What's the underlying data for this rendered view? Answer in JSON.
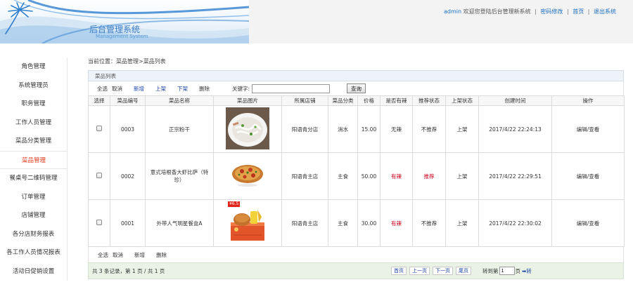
{
  "header": {
    "system_title": "后台管理系统",
    "system_subtitle": "Management System",
    "user": "admin",
    "welcome": "欢迎您登陆后台管理新系统",
    "links": [
      "密码修改",
      "首页",
      "退出系统"
    ],
    "separator": "|"
  },
  "sidebar": {
    "items": [
      {
        "label": "角色管理",
        "active": false
      },
      {
        "label": "系统管理员",
        "active": false
      },
      {
        "label": "职务管理",
        "active": false
      },
      {
        "label": "工作人员管理",
        "active": false
      },
      {
        "label": "菜品分类管理",
        "active": false
      },
      {
        "label": "菜品管理",
        "active": true
      },
      {
        "label": "餐桌号二维码管理",
        "active": false
      },
      {
        "label": "订单管理",
        "active": false
      },
      {
        "label": "店铺管理",
        "active": false
      },
      {
        "label": "各分店财务报表",
        "active": false
      },
      {
        "label": "各工作人员情况报表",
        "active": false
      },
      {
        "label": "活动日促销设置",
        "active": false
      }
    ]
  },
  "breadcrumb": "当前位置：菜品管理>菜品列表",
  "panel": {
    "title": "菜品列表",
    "toolbar": {
      "select_all": "全选",
      "cancel": "取消",
      "add": "新增",
      "on_shelf": "上架",
      "off_shelf": "下架",
      "delete": "删除",
      "keyword_label": "关键字:",
      "keyword_value": "",
      "search": "查询"
    },
    "table": {
      "headers": [
        "选择",
        "菜品编号",
        "菜品名称",
        "菜品图片",
        "所属店铺",
        "菜品分类",
        "价格",
        "是否有辣",
        "推荐状态",
        "上架状态",
        "创建时间",
        "操作"
      ],
      "rows": [
        {
          "id": "0003",
          "name": "正宗粉干",
          "shop": "阳语青分店",
          "category": "消水",
          "price": "15.00",
          "spicy": "无辣",
          "spicy_red": false,
          "recommend": "不推荐",
          "recommend_red": false,
          "shelf": "上架",
          "created": "2017/4/22 22:24:13",
          "action": "编辑/查看",
          "image_icon": "rice-noodle-bowl-icon"
        },
        {
          "id": "0002",
          "name": "意式培根香大虾比萨（特珍）",
          "shop": "阳语青主店",
          "category": "主食",
          "price": "50.00",
          "spicy": "有辣",
          "spicy_red": true,
          "recommend": "推荐",
          "recommend_red": true,
          "shelf": "上架",
          "created": "2017/4/22 22:29:51",
          "action": "编辑/查看",
          "image_icon": "pizza-icon"
        },
        {
          "id": "0001",
          "name": "外带人气明星餐盒A",
          "shop": "阳语青主店",
          "category": "主食",
          "price": "30.00",
          "spicy": "有辣",
          "spicy_red": true,
          "recommend": "不推荐",
          "recommend_red": false,
          "shelf": "上架",
          "created": "2017/4/22 22:30:02",
          "action": "编辑/查看",
          "image_icon": "meal-box-icon",
          "image_badge": "¥6.5"
        }
      ]
    },
    "bottom_toolbar": {
      "select_all": "全选",
      "cancel": "取消",
      "add": "新增",
      "delete": "删除"
    },
    "pager": {
      "summary": "共 3 条记录，第 1 页 / 共 1 页",
      "first": "首页",
      "prev": "上一页",
      "next": "下一页",
      "last": "尾页",
      "goto_label": "转到第",
      "page_value": "1",
      "page_unit": "页",
      "go": "➡转"
    }
  },
  "colors": {
    "accent_blue": "#1a6fc4",
    "active_red": "#e63b1c",
    "pager_bg": "#eaf2e6"
  }
}
